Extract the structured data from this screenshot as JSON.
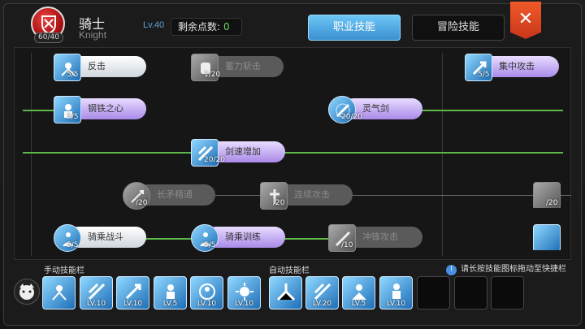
{
  "header": {
    "class_name": "骑士",
    "class_name_en": "Knight",
    "hp_badge": "60/40",
    "level": "Lv.40",
    "points_label": "剩余点数:",
    "points_value": "0"
  },
  "tabs": [
    {
      "label": "职业技能",
      "active": true
    },
    {
      "label": "冒险技能",
      "active": false
    }
  ],
  "close_label": "✕",
  "skills": [
    {
      "name": "反击",
      "level": "5/5",
      "style": "white"
    },
    {
      "name": "蓄力斩击",
      "level": "1/20",
      "style": "grey"
    },
    {
      "name": "集中攻击",
      "level": "5/5",
      "style": "purple"
    },
    {
      "name": "钢铁之心",
      "level": "5/5",
      "style": "purple"
    },
    {
      "name": "灵气剑",
      "level": "20/20",
      "style": "purple"
    },
    {
      "name": "剑速增加",
      "level": "20/20",
      "style": "purple"
    },
    {
      "name": "长矛精通",
      "level": "/20",
      "style": "grey"
    },
    {
      "name": "连续攻击",
      "level": "/20",
      "style": "grey"
    },
    {
      "name": "",
      "level": "/20",
      "style": "grey"
    },
    {
      "name": "骑乘战斗",
      "level": "5/5",
      "style": "white"
    },
    {
      "name": "骑乘训练",
      "level": "5/5",
      "style": "purple"
    },
    {
      "name": "冲锋攻击",
      "level": "/10",
      "style": "grey"
    }
  ],
  "manual_bar": {
    "label": "手动技能栏",
    "slots": [
      "",
      "LV.10",
      "LV.10",
      "LV.5",
      "LV.10",
      "LV.10"
    ]
  },
  "auto_bar": {
    "label": "自动技能栏",
    "slots": [
      "",
      "LV.20",
      "LV.5",
      "LV.10"
    ]
  },
  "hint": "请长按技能图标拖动至快捷栏",
  "colors": {
    "accent": "#3b8fd0",
    "close": "#e04a22",
    "green_line": "#5db84a"
  }
}
